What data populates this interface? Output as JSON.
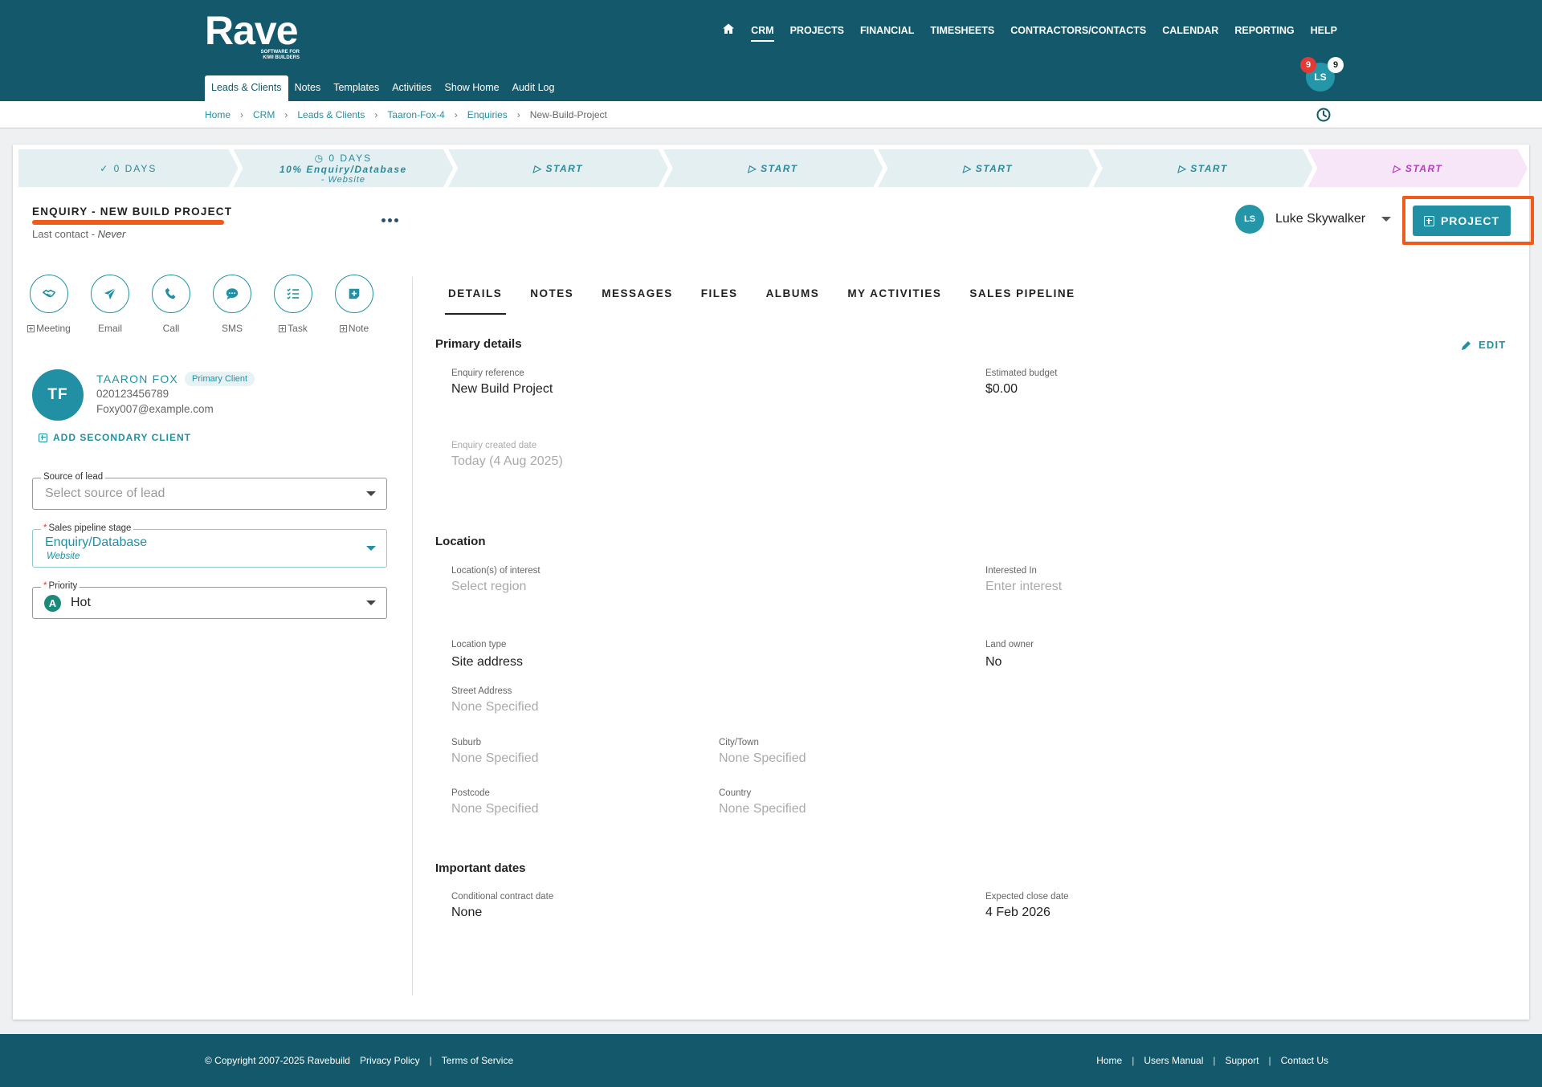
{
  "logo": {
    "main": "Rave",
    "sub_line1": "SOFTWARE FOR",
    "sub_line2": "KIWI BUILDERS"
  },
  "main_nav": [
    {
      "label": "CRM",
      "active": true
    },
    {
      "label": "PROJECTS"
    },
    {
      "label": "FINANCIAL"
    },
    {
      "label": "TIMESHEETS"
    },
    {
      "label": "CONTRACTORS/CONTACTS"
    },
    {
      "label": "CALENDAR"
    },
    {
      "label": "REPORTING"
    },
    {
      "label": "HELP"
    }
  ],
  "sub_nav": [
    {
      "label": "Leads & Clients",
      "active": true
    },
    {
      "label": "Notes"
    },
    {
      "label": "Templates"
    },
    {
      "label": "Activities"
    },
    {
      "label": "Show Home"
    },
    {
      "label": "Audit Log"
    }
  ],
  "user": {
    "initials": "LS",
    "badge_red": "9",
    "badge_white": "9"
  },
  "breadcrumb": [
    "Home",
    "CRM",
    "Leads & Clients",
    "Taaron-Fox-4",
    "Enquiries",
    "New-Build-Project"
  ],
  "pipeline": [
    {
      "line1": "✓ 0 DAYS"
    },
    {
      "line1": "◷ 0 DAYS",
      "line2": "10% Enquiry/Database",
      "line3": "- Website"
    },
    {
      "line1": "▷ START"
    },
    {
      "line1": "▷ START"
    },
    {
      "line1": "▷ START"
    },
    {
      "line1": "▷ START"
    },
    {
      "line1": "▷ START"
    }
  ],
  "enquiry": {
    "title": "ENQUIRY - NEW BUILD PROJECT",
    "last_contact_label": "Last contact - ",
    "last_contact_value": "Never"
  },
  "owner": {
    "initials": "LS",
    "name": "Luke Skywalker"
  },
  "project_button": "PROJECT",
  "actions": [
    {
      "label": "Meeting",
      "plus": true
    },
    {
      "label": "Email",
      "plus": false
    },
    {
      "label": "Call",
      "plus": false
    },
    {
      "label": "SMS",
      "plus": false
    },
    {
      "label": "Task",
      "plus": true
    },
    {
      "label": "Note",
      "plus": true
    }
  ],
  "client": {
    "initials": "TF",
    "name": "TAARON FOX",
    "badge": "Primary Client",
    "phone": "020123456789",
    "email": "Foxy007@example.com",
    "add_secondary": "ADD SECONDARY CLIENT"
  },
  "fields": {
    "source": {
      "label": "Source of lead",
      "placeholder": "Select source of lead"
    },
    "stage": {
      "label": "Sales pipeline stage",
      "value": "Enquiry/Database",
      "sub": "Website"
    },
    "priority": {
      "label": "Priority",
      "badge": "A",
      "value": "Hot"
    }
  },
  "tabs": [
    "DETAILS",
    "NOTES",
    "MESSAGES",
    "FILES",
    "ALBUMS",
    "MY ACTIVITIES",
    "SALES PIPELINE"
  ],
  "details": {
    "primary_title": "Primary details",
    "edit": "EDIT",
    "enquiry_ref_label": "Enquiry reference",
    "enquiry_ref_value": "New Build Project",
    "budget_label": "Estimated budget",
    "budget_value": "$0.00",
    "created_label": "Enquiry created date",
    "created_value": "Today (4 Aug 2025)",
    "location_title": "Location",
    "loc_interest_label": "Location(s) of interest",
    "loc_interest_value": "Select region",
    "interested_in_label": "Interested In",
    "interested_in_value": "Enter interest",
    "loc_type_label": "Location type",
    "loc_type_value": "Site address",
    "land_owner_label": "Land owner",
    "land_owner_value": "No",
    "street_label": "Street Address",
    "street_value": "None Specified",
    "suburb_label": "Suburb",
    "suburb_value": "None Specified",
    "city_label": "City/Town",
    "city_value": "None Specified",
    "postcode_label": "Postcode",
    "postcode_value": "None Specified",
    "country_label": "Country",
    "country_value": "None Specified",
    "dates_title": "Important dates",
    "conditional_label": "Conditional contract date",
    "conditional_value": "None",
    "close_label": "Expected close date",
    "close_value": "4 Feb 2026"
  },
  "footer": {
    "copyright": "© Copyright 2007-2025 Ravebuild",
    "privacy": "Privacy Policy",
    "terms": "Terms of Service",
    "right_links": [
      "Home",
      "Users Manual",
      "Support",
      "Contact Us"
    ]
  },
  "colors": {
    "header": "#13596b",
    "accent": "#2190a4",
    "highlight": "#f05a1a"
  }
}
